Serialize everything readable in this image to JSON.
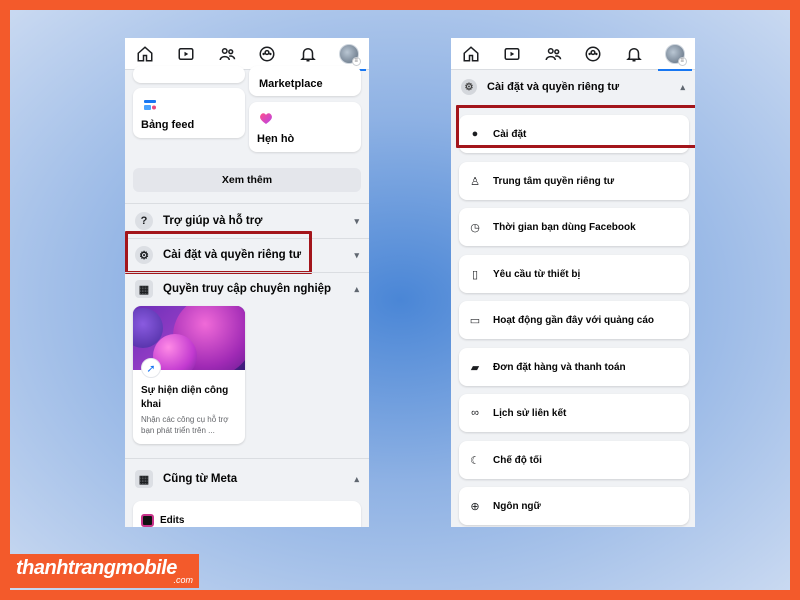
{
  "left_phone": {
    "nav": [
      "home-icon",
      "video-icon",
      "friends-icon",
      "groups-icon",
      "bell-icon",
      "profile-avatar"
    ],
    "shortcuts": [
      {
        "label": "Bảng feed",
        "icon": "feed-icon"
      },
      {
        "label": "Marketplace",
        "icon": "marketplace-icon"
      },
      {
        "label": "Hẹn hò",
        "icon": "heart-icon"
      }
    ],
    "see_more": "Xem thêm",
    "help_label": "Trợ giúp và hỗ trợ",
    "settings_label": "Cài đặt và quyền riêng tư",
    "pro_label": "Quyền truy cập chuyên nghiệp",
    "pro_card": {
      "title": "Sự hiện diện công khai",
      "desc": "Nhận các công cụ hỗ trợ bạn phát triển trên ..."
    },
    "meta_label": "Cũng từ Meta",
    "meta_items": [
      {
        "label": "Edits"
      }
    ]
  },
  "right_phone": {
    "section_title": "Cài đặt và quyền riêng tư",
    "menu": [
      {
        "label": "Cài đặt",
        "icon": "user-circle-icon"
      },
      {
        "label": "Trung tâm quyền riêng tư",
        "icon": "lock-person-icon"
      },
      {
        "label": "Thời gian bạn dùng Facebook",
        "icon": "clock-icon"
      },
      {
        "label": "Yêu cầu từ thiết bị",
        "icon": "device-icon"
      },
      {
        "label": "Hoạt động gần đây với quảng cáo",
        "icon": "ad-activity-icon"
      },
      {
        "label": "Đơn đặt hàng và thanh toán",
        "icon": "card-icon"
      },
      {
        "label": "Lịch sử liên kết",
        "icon": "link-icon"
      },
      {
        "label": "Chế độ tối",
        "icon": "moon-icon"
      },
      {
        "label": "Ngôn ngữ",
        "icon": "globe-icon"
      }
    ]
  },
  "watermark": {
    "main": "thanhtrangmobile",
    "sub": ".com"
  },
  "colors": {
    "highlight": "#a3151b",
    "brand": "#1877f2",
    "watermark_bg": "#f35a2b"
  }
}
